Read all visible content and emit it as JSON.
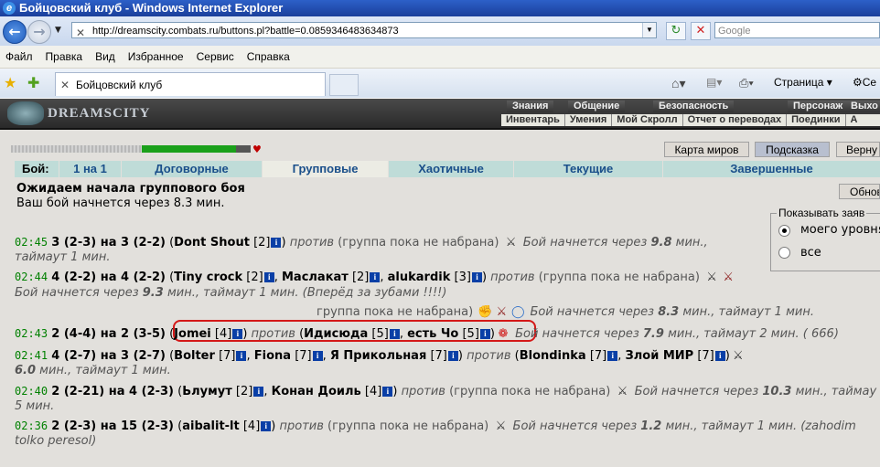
{
  "window": {
    "title": "Бойцовский клуб - Windows Internet Explorer"
  },
  "address": {
    "url": "http://dreamscity.combats.ru/buttons.pl?battle=0.0859346483634873",
    "search_placeholder": "Google"
  },
  "menu": [
    "Файл",
    "Правка",
    "Вид",
    "Избранное",
    "Сервис",
    "Справка"
  ],
  "tab": {
    "title": "Бойцовский клуб"
  },
  "command_bar": {
    "page": "Страница",
    "safety": "Се"
  },
  "game_header": {
    "logo": "DREAMSCITY",
    "top_menu": [
      "Знания",
      "Общение",
      "Безопасность",
      "Персонаж",
      "Выхо"
    ],
    "sub_menu": [
      "Инвентарь",
      "Умения",
      "Мой Скролл",
      "Отчет о переводах",
      "Поединки",
      "А"
    ]
  },
  "buttons": {
    "map": "Карта миров",
    "hint": "Подсказка",
    "return": "Верну",
    "refresh": "Обнов"
  },
  "battle_tabs": {
    "label": "Бой:",
    "items": [
      "1 на 1",
      "Договорные",
      "Групповые",
      "Хаотичные",
      "Текущие",
      "Завершенные"
    ],
    "selected": 2
  },
  "wait": {
    "heading": "Ожидаем начала группового боя",
    "text": "Ваш бой начнется через 8.3 мин."
  },
  "filter": {
    "legend": "Показывать заяв",
    "options": [
      "моего уровня",
      "все"
    ],
    "selected": 0
  },
  "hp": {
    "fraction": 0.94
  },
  "rows": {
    "r1": {
      "time": "02:45",
      "teams": "3 (2-3) на 3 (2-2)",
      "p1": "Dont Shout",
      "p1lvl": "[2]",
      "vs": "против",
      "opp": "(группа пока не набрана)",
      "starts_pre": "Бой начнется через",
      "starts_val": "9.8",
      "starts_post": "мин.,",
      "line2": "таймаут 1 мин."
    },
    "r2": {
      "time": "02:44",
      "teams": "4 (2-2) на 4 (2-2)",
      "p1": "Tiny crock",
      "p1lvl": "[2]",
      "p2": "Маслакат",
      "p2lvl": "[2]",
      "p3": "alukardik",
      "p3lvl": "[3]",
      "vs": "против",
      "opp": "(группа пока не набрана)",
      "line2_pre": "Бой начнется через",
      "line2_val": "9.3",
      "line2_post": "мин., таймаут 1 мин. (Вперёд за зубами !!!!)"
    },
    "r3": {
      "opp": "группа пока не набрана)",
      "starts_pre": "Бой начнется через",
      "starts_val": "8.3",
      "starts_post": "мин., таймаут 1 мин."
    },
    "r4": {
      "time": "02:43",
      "teams": "2 (4-4) на 2 (3-5)",
      "p1": "Jomei",
      "p1lvl": "[4]",
      "vs": "против",
      "p2": "Идисюда",
      "p2lvl": "[5]",
      "p3": "есть Чо",
      "p3lvl": "[5]",
      "starts_pre": "Бой начнется через",
      "starts_val": "7.9",
      "starts_post": "мин., таймаут 2 мин. ( 666)"
    },
    "r5": {
      "time": "02:41",
      "teams": "4 (2-7) на 3 (2-7)",
      "p1": "Bolter",
      "p1lvl": "[7]",
      "p2": "Fiona",
      "p2lvl": "[7]",
      "p3": "Я Прикольная",
      "p3lvl": "[7]",
      "vs": "против",
      "p4": "Blondinka",
      "p4lvl": "[7]",
      "p5": "Злой МИР",
      "p5lvl": "[7]",
      "line2_val": "6.0",
      "line2_post": "мин., таймаут 1 мин."
    },
    "r6": {
      "time": "02:40",
      "teams": "2 (2-21) на 4 (2-3)",
      "p1": "Ьлумут",
      "p1lvl": "[2]",
      "p2": "Конан Доиль",
      "p2lvl": "[4]",
      "vs": "против",
      "opp": "(группа пока не набрана)",
      "starts_pre": "Бой начнется через",
      "starts_val": "10.3",
      "starts_post": "мин., таймау",
      "line2": "5 мин."
    },
    "r7": {
      "time": "02:36",
      "teams": "2 (2-3) на 15 (2-3)",
      "p1": "aibalit-lt",
      "p1lvl": "[4]",
      "vs": "против",
      "opp": "(группа пока не набрана)",
      "starts_pre": "Бой начнется через",
      "starts_val": "1.2",
      "starts_post": "мин., таймаут 1 мин. (zahodim",
      "line2": "tolko peresol)"
    }
  }
}
